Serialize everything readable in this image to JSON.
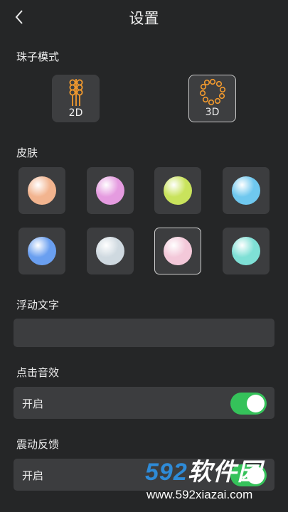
{
  "header": {
    "title": "设置",
    "back_icon": "chevron-left-icon"
  },
  "bead_mode": {
    "label": "珠子模式",
    "options": [
      {
        "label": "2D",
        "icon": "bead-string-icon",
        "color": "#f29a2e",
        "selected": false
      },
      {
        "label": "3D",
        "icon": "bead-ring-icon",
        "color": "#f29a2e",
        "selected": true
      }
    ]
  },
  "skin": {
    "label": "皮肤",
    "selected_index": 6,
    "colors": [
      "#f2b48f",
      "#e59be0",
      "#c9e35c",
      "#6fc8ef",
      "#6a9ff0",
      "#cfd9e0",
      "#f3c8d9",
      "#7fe0d6"
    ]
  },
  "floating_text": {
    "label": "浮动文字",
    "value": ""
  },
  "click_sound": {
    "label": "点击音效",
    "row_text": "开启",
    "enabled": true
  },
  "vibration": {
    "label": "震动反馈",
    "row_text": "开启",
    "enabled": true
  },
  "watermark": {
    "brand_num": "592",
    "brand_cn": "软件园",
    "url": "www.592xiazai.com"
  },
  "colors": {
    "background": "#252627",
    "tile": "#3c3d3f",
    "toggle_on": "#35c25a",
    "accent": "#f29a2e"
  }
}
